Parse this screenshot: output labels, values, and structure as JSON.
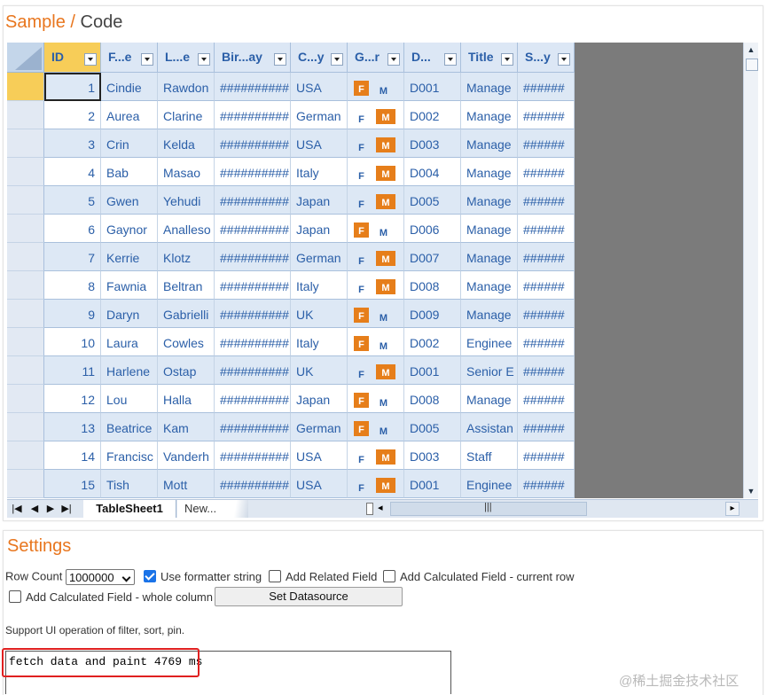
{
  "header": {
    "title_sample": "Sample",
    "title_sep": "/",
    "title_code": "Code"
  },
  "grid": {
    "columns": [
      "ID",
      "F...e",
      "L...e",
      "Bir...ay",
      "C...y",
      "G...r",
      "D...",
      "Title",
      "S...y"
    ],
    "rows": [
      {
        "id": "1",
        "first": "Cindie",
        "last": "Rawdon",
        "birthday": "##########",
        "country": "USA",
        "gender": "F",
        "dept": "D001",
        "title": "Manage",
        "salary": "######"
      },
      {
        "id": "2",
        "first": "Aurea",
        "last": "Clarine",
        "birthday": "##########",
        "country": "German",
        "gender": "M",
        "dept": "D002",
        "title": "Manage",
        "salary": "######"
      },
      {
        "id": "3",
        "first": "Crin",
        "last": "Kelda",
        "birthday": "##########",
        "country": "USA",
        "gender": "M",
        "dept": "D003",
        "title": "Manage",
        "salary": "######"
      },
      {
        "id": "4",
        "first": "Bab",
        "last": "Masao",
        "birthday": "##########",
        "country": "Italy",
        "gender": "M",
        "dept": "D004",
        "title": "Manage",
        "salary": "######"
      },
      {
        "id": "5",
        "first": "Gwen",
        "last": "Yehudi",
        "birthday": "##########",
        "country": "Japan",
        "gender": "M",
        "dept": "D005",
        "title": "Manage",
        "salary": "######"
      },
      {
        "id": "6",
        "first": "Gaynor",
        "last": "Analleso",
        "birthday": "##########",
        "country": "Japan",
        "gender": "F",
        "dept": "D006",
        "title": "Manage",
        "salary": "######"
      },
      {
        "id": "7",
        "first": "Kerrie",
        "last": "Klotz",
        "birthday": "##########",
        "country": "German",
        "gender": "M",
        "dept": "D007",
        "title": "Manage",
        "salary": "######"
      },
      {
        "id": "8",
        "first": "Fawnia",
        "last": "Beltran",
        "birthday": "##########",
        "country": "Italy",
        "gender": "M",
        "dept": "D008",
        "title": "Manage",
        "salary": "######"
      },
      {
        "id": "9",
        "first": "Daryn",
        "last": "Gabrielli",
        "birthday": "##########",
        "country": "UK",
        "gender": "F",
        "dept": "D009",
        "title": "Manage",
        "salary": "######"
      },
      {
        "id": "10",
        "first": "Laura",
        "last": "Cowles",
        "birthday": "##########",
        "country": "Italy",
        "gender": "F",
        "dept": "D002",
        "title": "Enginee",
        "salary": "######"
      },
      {
        "id": "11",
        "first": "Harlene",
        "last": "Ostap",
        "birthday": "##########",
        "country": "UK",
        "gender": "M",
        "dept": "D001",
        "title": "Senior E",
        "salary": "######"
      },
      {
        "id": "12",
        "first": "Lou",
        "last": "Halla",
        "birthday": "##########",
        "country": "Japan",
        "gender": "F",
        "dept": "D008",
        "title": "Manage",
        "salary": "######"
      },
      {
        "id": "13",
        "first": "Beatrice",
        "last": "Kam",
        "birthday": "##########",
        "country": "German",
        "gender": "F",
        "dept": "D005",
        "title": "Assistan",
        "salary": "######"
      },
      {
        "id": "14",
        "first": "Francisc",
        "last": "Vanderh",
        "birthday": "##########",
        "country": "USA",
        "gender": "M",
        "dept": "D003",
        "title": "Staff",
        "salary": "######"
      },
      {
        "id": "15",
        "first": "Tish",
        "last": "Mott",
        "birthday": "##########",
        "country": "USA",
        "gender": "M",
        "dept": "D001",
        "title": "Enginee",
        "salary": "######"
      }
    ],
    "gender_labels": {
      "f": "F",
      "m": "M"
    }
  },
  "sheet_tabs": {
    "active": "TableSheet1",
    "new_tab": "New..."
  },
  "settings": {
    "title": "Settings",
    "row_count_label": "Row Count",
    "row_count_value": "1000000",
    "use_formatter_label": "Use formatter string",
    "add_related_label": "Add Related Field",
    "add_calc_current_label": "Add Calculated Field - current row",
    "add_calc_column_label": "Add Calculated Field - whole column",
    "set_datasource_label": "Set Datasource",
    "support_text": "Support UI operation of filter, sort, pin.",
    "log_text": "fetch data and paint 4769 ms",
    "checkbox_states": {
      "use_formatter": true,
      "add_related": false,
      "add_calc_current": false,
      "add_calc_column": false
    }
  },
  "watermark": "@稀土掘金技术社区",
  "colors": {
    "accent": "#e8761e",
    "grid_text": "#2b5fa8",
    "highlight": "#e02020"
  }
}
